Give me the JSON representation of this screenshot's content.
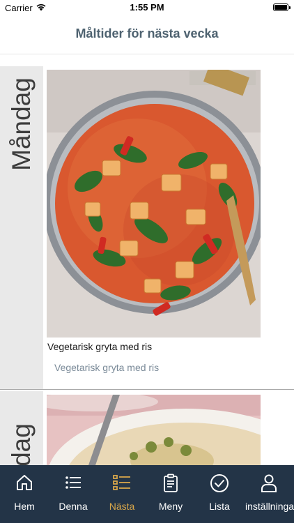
{
  "status_bar": {
    "carrier": "Carrier",
    "time": "1:55 PM"
  },
  "header": {
    "title": "Måltider för nästa vecka"
  },
  "days": [
    {
      "day": "Måndag",
      "meal_title": "Vegetarisk gryta med ris",
      "meal_subtitle": "Vegetarisk gryta med ris"
    },
    {
      "day": "Tisdag"
    }
  ],
  "tabs": [
    {
      "label": "Hem",
      "icon": "home-icon"
    },
    {
      "label": "Denna",
      "icon": "list-icon"
    },
    {
      "label": "Nästa",
      "icon": "checklist-icon",
      "active": true
    },
    {
      "label": "Meny",
      "icon": "clipboard-icon"
    },
    {
      "label": "Lista",
      "icon": "check-circle-icon"
    },
    {
      "label": "inställningar",
      "icon": "person-icon"
    }
  ],
  "colors": {
    "tab_bar": "#233447",
    "active_tab": "#d7a64a",
    "title": "#4e6270"
  }
}
